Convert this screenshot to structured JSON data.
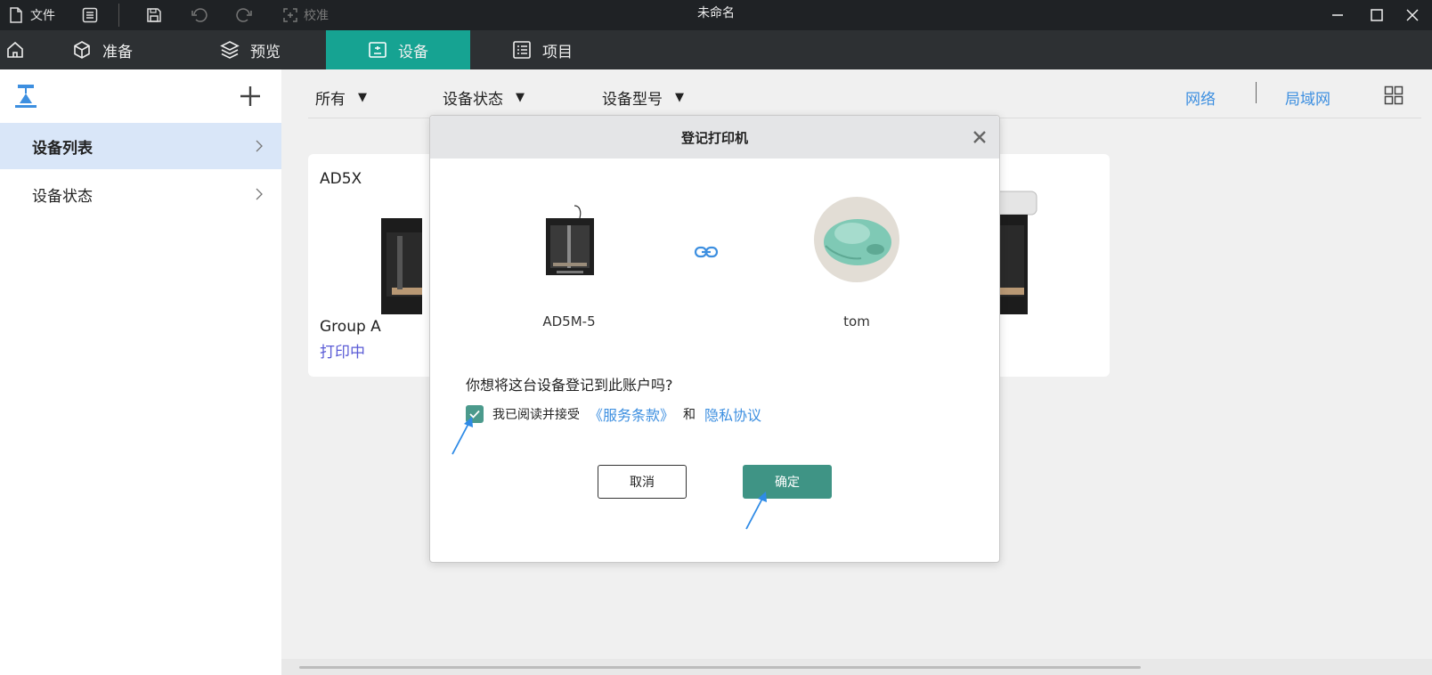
{
  "titlebar": {
    "file_label": "文件",
    "calibrate_label": "校准",
    "window_title": "未命名",
    "icons": [
      "file-icon",
      "menu-list-icon",
      "save-icon",
      "undo-icon",
      "redo-icon",
      "calibrate-icon",
      "minimize-icon",
      "maximize-icon",
      "close-icon"
    ]
  },
  "nav": {
    "tabs": [
      {
        "label": "准备",
        "icon": "cube-icon"
      },
      {
        "label": "预览",
        "icon": "layers-icon"
      },
      {
        "label": "设备",
        "icon": "device-icon",
        "active": true
      },
      {
        "label": "项目",
        "icon": "project-list-icon"
      }
    ],
    "active_color": "#16a392"
  },
  "sidebar": {
    "items": [
      {
        "label": "设备列表",
        "active": true
      },
      {
        "label": "设备状态",
        "active": false
      }
    ]
  },
  "filters": {
    "all": "所有",
    "device_status": "设备状态",
    "device_model": "设备型号",
    "network": "网络",
    "lan": "局域网"
  },
  "card": {
    "name": "AD5X",
    "group": "Group A",
    "status": "打印中"
  },
  "dialog": {
    "title": "登记打印机",
    "device_name": "AD5M-5",
    "user_name": "tom",
    "question": "你想将这台设备登记到此账户吗?",
    "agree_text": "我已阅读并接受",
    "terms_link": "《服务条款》",
    "and_text": "和",
    "privacy_link": "隐私协议",
    "checked": true,
    "cancel_label": "取消",
    "ok_label": "确定",
    "accent_color": "#3f9485",
    "link_color": "#3d8fe0"
  }
}
